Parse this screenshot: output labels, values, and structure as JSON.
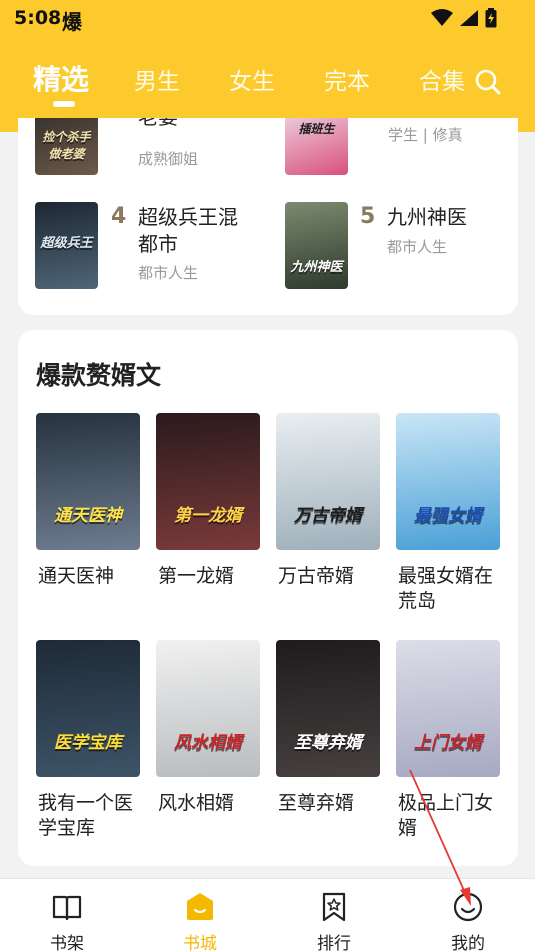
{
  "status_bar": {
    "time": "5:08",
    "app_indicator": "爆"
  },
  "top_tabs": {
    "items": [
      {
        "label": "精选",
        "active": true
      },
      {
        "label": "男生",
        "active": false
      },
      {
        "label": "女生",
        "active": false
      },
      {
        "label": "完本",
        "active": false
      },
      {
        "label": "合集",
        "active": false
      }
    ]
  },
  "ranking": {
    "items": [
      {
        "rank": "",
        "title": "老婆",
        "tag": "成熟御姐",
        "cover_text": "捡个杀手做老婆"
      },
      {
        "rank": "",
        "title": "",
        "tag": "学生 | 修真",
        "cover_text": "插班生"
      },
      {
        "rank": "4",
        "title": "超级兵王混都市",
        "tag": "都市人生",
        "cover_text": "超级兵王"
      },
      {
        "rank": "5",
        "title": "九州神医",
        "tag": "都市人生",
        "cover_text": "九州神医"
      }
    ]
  },
  "popular_section": {
    "title": "爆款赘婿文",
    "books": [
      {
        "title": "通天医神",
        "cover_text": "通天医神",
        "colors": [
          "#26323e",
          "#6d7c8f"
        ],
        "title_color": "#ffe24a"
      },
      {
        "title": "第一龙婿",
        "cover_text": "第一龙婿",
        "colors": [
          "#2a1a1c",
          "#7a3a3a"
        ],
        "title_color": "#ffd34a"
      },
      {
        "title": "万古帝婿",
        "cover_text": "万古帝婿",
        "colors": [
          "#e9eef1",
          "#9fb0bb"
        ],
        "title_color": "#1d1d1d"
      },
      {
        "title": "最强女婿在荒岛",
        "cover_text": "最强女婿",
        "colors": [
          "#c9e6f6",
          "#4aa0d6"
        ],
        "title_color": "#1e4fb0"
      },
      {
        "title": "我有一个医学宝库",
        "cover_text": "医学宝库",
        "colors": [
          "#1e2a36",
          "#3d5468"
        ],
        "title_color": "#ffde3a"
      },
      {
        "title": "风水相婿",
        "cover_text": "风水相婿",
        "colors": [
          "#f1f1f1",
          "#b9bcbf"
        ],
        "title_color": "#c8252b"
      },
      {
        "title": "至尊弃婿",
        "cover_text": "至尊弃婿",
        "colors": [
          "#1f1b1d",
          "#46403f"
        ],
        "title_color": "#ffffff"
      },
      {
        "title": "极品上门女婿",
        "cover_text": "上门女婿",
        "colors": [
          "#dcdde8",
          "#a7a9c2"
        ],
        "title_color": "#c6232f"
      }
    ]
  },
  "bottom_nav": {
    "items": [
      {
        "label": "书架",
        "active": false
      },
      {
        "label": "书城",
        "active": true
      },
      {
        "label": "排行",
        "active": false
      },
      {
        "label": "我的",
        "active": false
      }
    ]
  },
  "colors": {
    "brand_yellow": "#fcca2c",
    "active_nav": "#f5b800",
    "annotation_red": "#e53935"
  }
}
